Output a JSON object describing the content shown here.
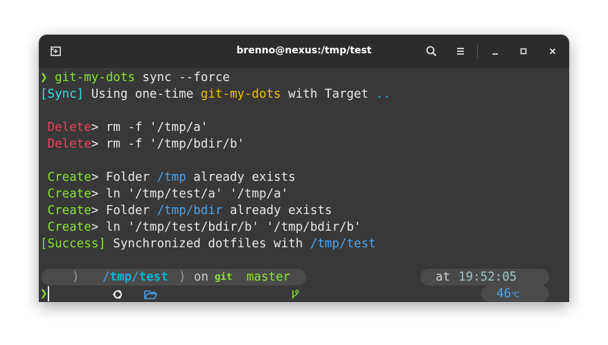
{
  "window": {
    "title": "brenno@nexus:/tmp/test"
  },
  "icons": {
    "new_tab": "new-tab-icon",
    "search": "search-icon",
    "menu": "hamburger-menu-icon",
    "minimize": "minimize-icon",
    "maximize": "maximize-icon",
    "close": "close-icon",
    "os": "ubuntu-icon",
    "folder": "folder-open-icon",
    "git": "git-branch-icon",
    "clock": "clock-icon",
    "weather": "cube-icon"
  },
  "terminal": {
    "cmd": {
      "prompt": "❯",
      "program": "git-my-dots",
      "args": " sync --force"
    },
    "sync": {
      "tag": "[Sync]",
      "text1": " Using one-time ",
      "name": "git-my-dots",
      "text2": " with Target ",
      "target": ".."
    },
    "deletes": [
      {
        "tag": "Delete",
        "text": "> rm -f '/tmp/a'"
      },
      {
        "tag": "Delete",
        "text": "> rm -f '/tmp/bdir/b'"
      }
    ],
    "creates": [
      {
        "tag": "Create",
        "pre": "> Folder ",
        "path": "/tmp",
        "post": " already exists"
      },
      {
        "tag": "Create",
        "pre": "> ln '/tmp/test/a' '/tmp/a'",
        "path": "",
        "post": ""
      },
      {
        "tag": "Create",
        "pre": "> Folder ",
        "path": "/tmp/bdir",
        "post": " already exists"
      },
      {
        "tag": "Create",
        "pre": "> ln '/tmp/test/bdir/b' '/tmp/bdir/b'",
        "path": "",
        "post": ""
      }
    ],
    "success": {
      "tag": "[Success]",
      "text": " Synchronized dotfiles with ",
      "path": "/tmp/test"
    }
  },
  "statusline": {
    "path_sep": "/",
    "path_parent": "tmp",
    "path_current": "test",
    "on": "on",
    "git_label": "git",
    "branch": "master",
    "at": "at",
    "time": "19:52:05",
    "temperature": "46",
    "temp_unit": "℃"
  },
  "prompt": {
    "symbol": "❯"
  },
  "colors": {
    "green": "#8ae234",
    "cyan": "#34e2e2",
    "yellow": "#f0c000",
    "blue": "#4aa3f0",
    "red": "#ef3f5e",
    "background": "#383838",
    "titlebar": "#2c2c2c"
  }
}
